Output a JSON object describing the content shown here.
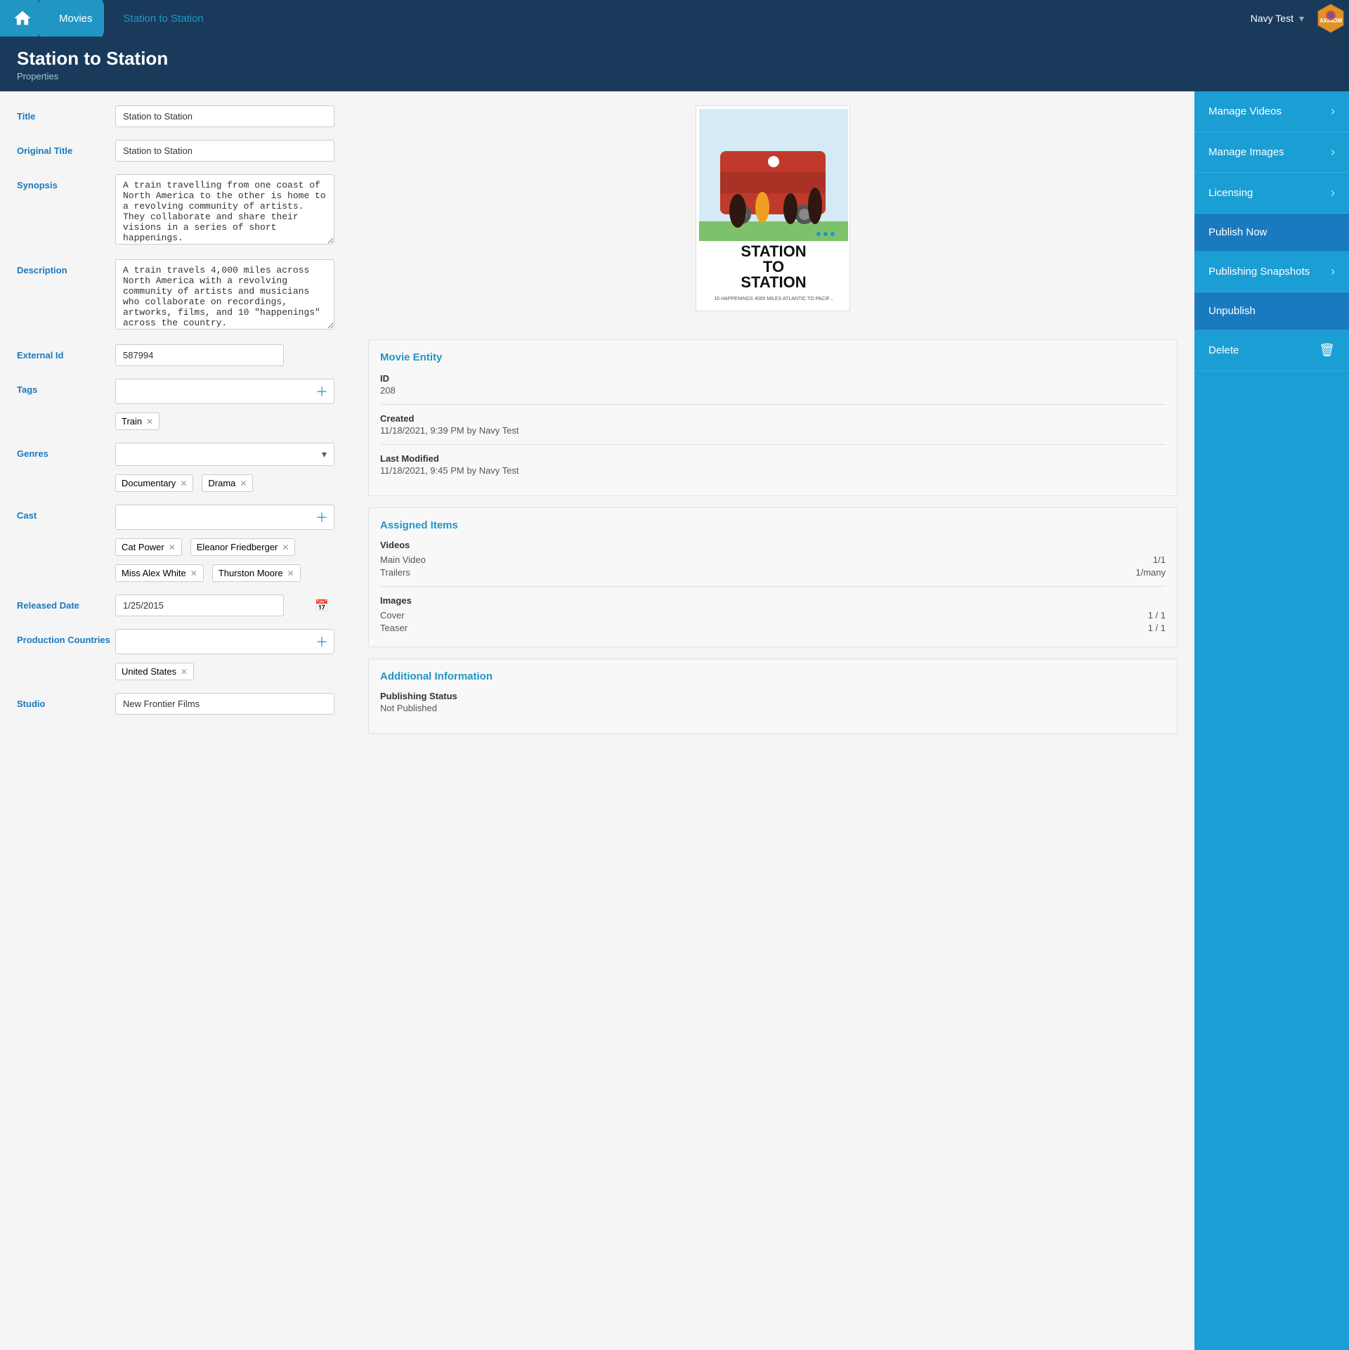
{
  "nav": {
    "home_label": "Home",
    "movies_label": "Movies",
    "current_label": "Station to Station",
    "user_label": "Navy Test"
  },
  "page": {
    "title": "Station to Station",
    "subtitle": "Properties"
  },
  "form": {
    "title_label": "Title",
    "title_value": "Station to Station",
    "original_title_label": "Original Title",
    "original_title_value": "Station to Station",
    "synopsis_label": "Synopsis",
    "synopsis_value": "A train travelling from one coast of North America to the other is home to a revolving community of artists. They collaborate and share their visions in a series of short happenings.",
    "description_label": "Description",
    "description_value": "A train travels 4,000 miles across North America with a revolving community of artists and musicians who collaborate on recordings, artworks, films, and 10 \"happenings\" across the country.",
    "external_id_label": "External Id",
    "external_id_value": "587994",
    "tags_label": "Tags",
    "tags_placeholder": "",
    "genres_label": "Genres",
    "cast_label": "Cast",
    "released_date_label": "Released Date",
    "released_date_value": "1/25/2015",
    "production_countries_label": "Production Countries",
    "studio_label": "Studio",
    "studio_value": "New Frontier Films"
  },
  "tags": [
    "Train"
  ],
  "genres": [
    "Documentary",
    "Drama"
  ],
  "cast": [
    "Cat Power",
    "Eleanor Friedberger",
    "Miss Alex White",
    "Thurston Moore"
  ],
  "production_countries": [
    "United States"
  ],
  "poster": {
    "title_line1": "STATION",
    "title_line2": "TO",
    "title_line3": "STATION",
    "subtitle_text": "10 HAPPENINGS 4000 MILES ATLANTIC TO PACIF..."
  },
  "entity": {
    "section_title": "Movie Entity",
    "id_label": "ID",
    "id_value": "208",
    "created_label": "Created",
    "created_value": "11/18/2021, 9:39 PM by Navy Test",
    "last_modified_label": "Last Modified",
    "last_modified_value": "11/18/2021, 9:45 PM by Navy Test"
  },
  "assigned_items": {
    "section_title": "Assigned Items",
    "videos_label": "Videos",
    "main_video_label": "Main Video",
    "main_video_value": "1/1",
    "trailers_label": "Trailers",
    "trailers_value": "1/many",
    "images_label": "Images",
    "cover_label": "Cover",
    "cover_value": "1 / 1",
    "teaser_label": "Teaser",
    "teaser_value": "1 / 1"
  },
  "additional": {
    "section_title": "Additional Information",
    "publishing_status_label": "Publishing Status",
    "publishing_status_value": "Not Published"
  },
  "sidebar": {
    "manage_videos_label": "Manage Videos",
    "manage_images_label": "Manage Images",
    "licensing_label": "Licensing",
    "publish_now_label": "Publish Now",
    "publishing_snapshots_label": "Publishing Snapshots",
    "unpublish_label": "Unpublish",
    "delete_label": "Delete"
  }
}
